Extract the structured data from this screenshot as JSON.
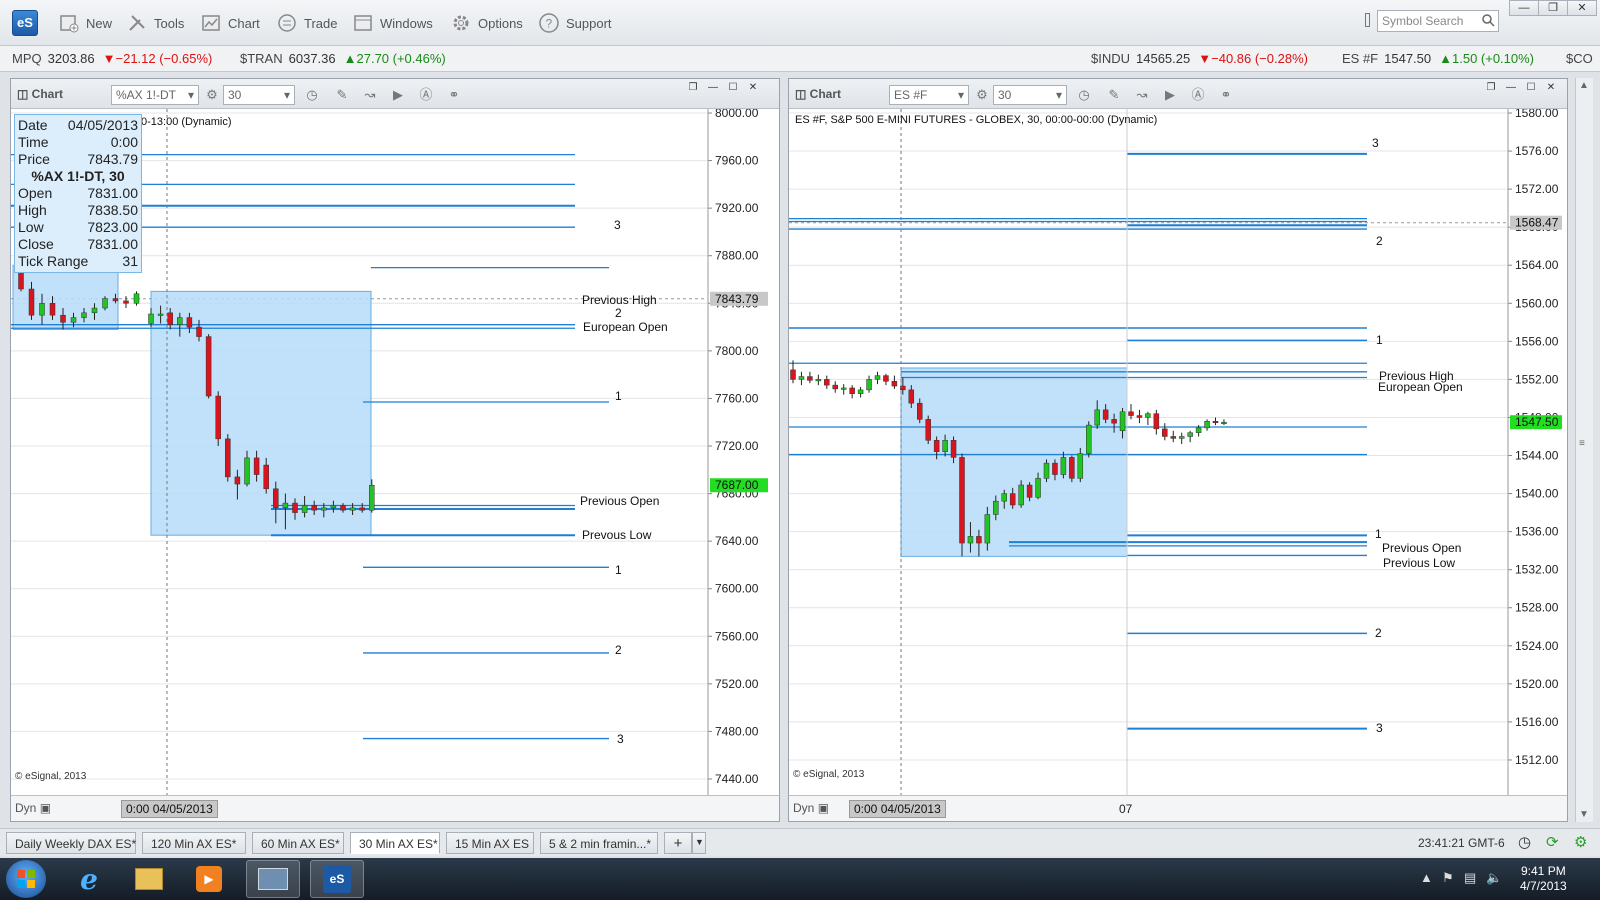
{
  "app": {
    "logo_text": "eS",
    "toolbar": [
      {
        "id": "new",
        "label": "New",
        "icon": "new-icon"
      },
      {
        "id": "tools",
        "label": "Tools",
        "icon": "tools-icon"
      },
      {
        "id": "chart",
        "label": "Chart",
        "icon": "chart-icon"
      },
      {
        "id": "trade",
        "label": "Trade",
        "icon": "trade-icon"
      },
      {
        "id": "windows",
        "label": "Windows",
        "icon": "windows-icon"
      },
      {
        "id": "options",
        "label": "Options",
        "icon": "gear-icon"
      },
      {
        "id": "support",
        "label": "Support",
        "icon": "help-icon"
      }
    ],
    "search_placeholder": "Symbol Search"
  },
  "ticker": [
    {
      "sym": "MPQ",
      "val": "3203.86",
      "chg": "▼−21.12 (−0.65%)",
      "dir": "down"
    },
    {
      "sym": "$TRAN",
      "val": "6037.36",
      "chg": "▲27.70 (+0.46%)",
      "dir": "up"
    },
    {
      "sym": "$INDU",
      "val": "14565.25",
      "chg": "▼−40.86 (−0.28%)",
      "dir": "down"
    },
    {
      "sym": "ES #F",
      "val": "1547.50",
      "chg": "▲1.50 (+0.10%)",
      "dir": "up"
    },
    {
      "sym": "$CO",
      "val": "",
      "chg": "",
      "dir": ""
    }
  ],
  "left_chart": {
    "header_title": "Chart",
    "symbol": "%AX 1!-DT",
    "interval": "30",
    "subtitle": "0-13:00 (Dynamic)",
    "copyright": "© eSignal, 2013",
    "footer_dyn": "Dyn",
    "footer_date": "0:00 04/05/2013",
    "last_price": "7687.00",
    "cursor_price": "7843.79",
    "tooltip": {
      "date_label": "Date",
      "date": "04/05/2013",
      "time_label": "Time",
      "time": "0:00",
      "price_label": "Price",
      "price": "7843.79",
      "symbol_title": "%AX 1!-DT, 30",
      "open_label": "Open",
      "open": "7831.00",
      "high_label": "High",
      "high": "7838.50",
      "low_label": "Low",
      "low": "7823.00",
      "close_label": "Close",
      "close": "7831.00",
      "range_label": "Tick Range",
      "range": "31"
    },
    "annotations": {
      "prev_high": "Previous High",
      "euro_open": "European Open",
      "prev_open": "Previous Open",
      "prev_low": "Prevous Low",
      "n3a": "3",
      "n2a": "2",
      "n1a": "1",
      "n1b": "1",
      "n2b": "2",
      "n3b": "3"
    }
  },
  "right_chart": {
    "header_title": "Chart",
    "symbol": "ES #F",
    "interval": "30",
    "subtitle": "ES #F, S&P 500 E-MINI FUTURES - GLOBEX, 30, 00:00-00:00 (Dynamic)",
    "copyright": "© eSignal, 2013",
    "footer_dyn": "Dyn",
    "footer_date": "0:00 04/05/2013",
    "footer_day": "07",
    "last_price": "1547.50",
    "cursor_price": "1568.47",
    "annotations": {
      "n3a": "3",
      "n2a": "2",
      "n1a": "1",
      "prev_high": "Previous High",
      "euro_open": "European Open",
      "n1b": "1",
      "prev_open": "Previous Open",
      "prev_low": "Previous Low",
      "n2b": "2",
      "n3b": "3"
    }
  },
  "chart_data": [
    {
      "type": "candlestick",
      "symbol": "%AX 1!-DT",
      "interval": "30",
      "ylim": [
        7440,
        8000
      ],
      "yticks": [
        "8000.00",
        "7960.00",
        "7920.00",
        "7880.00",
        "7840.00",
        "7800.00",
        "7760.00",
        "7720.00",
        "7680.00",
        "7640.00",
        "7600.00",
        "7560.00",
        "7520.00",
        "7480.00",
        "7440.00"
      ],
      "levels": [
        7965,
        7940,
        7922,
        7904,
        7870,
        7822,
        7819,
        7757,
        7670,
        7667,
        7645,
        7618,
        7546,
        7474
      ],
      "candles": [
        {
          "o": 7866,
          "h": 7872,
          "l": 7850,
          "c": 7852
        },
        {
          "o": 7852,
          "h": 7858,
          "l": 7826,
          "c": 7830
        },
        {
          "o": 7830,
          "h": 7848,
          "l": 7822,
          "c": 7840
        },
        {
          "o": 7840,
          "h": 7846,
          "l": 7826,
          "c": 7830
        },
        {
          "o": 7830,
          "h": 7836,
          "l": 7818,
          "c": 7824
        },
        {
          "o": 7824,
          "h": 7832,
          "l": 7820,
          "c": 7828
        },
        {
          "o": 7828,
          "h": 7836,
          "l": 7824,
          "c": 7832
        },
        {
          "o": 7832,
          "h": 7840,
          "l": 7826,
          "c": 7836
        },
        {
          "o": 7836,
          "h": 7846,
          "l": 7834,
          "c": 7844
        },
        {
          "o": 7844,
          "h": 7848,
          "l": 7840,
          "c": 7842
        },
        {
          "o": 7842,
          "h": 7846,
          "l": 7836,
          "c": 7840
        },
        {
          "o": 7840,
          "h": 7850,
          "l": 7838,
          "c": 7848
        },
        {
          "o": 7823,
          "h": 7836,
          "l": 7820,
          "c": 7831
        },
        {
          "o": 7831,
          "h": 7838,
          "l": 7823,
          "c": 7831
        },
        {
          "o": 7832,
          "h": 7836,
          "l": 7818,
          "c": 7822
        },
        {
          "o": 7822,
          "h": 7832,
          "l": 7812,
          "c": 7828
        },
        {
          "o": 7828,
          "h": 7832,
          "l": 7815,
          "c": 7820
        },
        {
          "o": 7820,
          "h": 7826,
          "l": 7808,
          "c": 7812
        },
        {
          "o": 7812,
          "h": 7814,
          "l": 7760,
          "c": 7762
        },
        {
          "o": 7762,
          "h": 7766,
          "l": 7720,
          "c": 7726
        },
        {
          "o": 7726,
          "h": 7730,
          "l": 7690,
          "c": 7694
        },
        {
          "o": 7694,
          "h": 7700,
          "l": 7675,
          "c": 7688
        },
        {
          "o": 7688,
          "h": 7716,
          "l": 7686,
          "c": 7710
        },
        {
          "o": 7710,
          "h": 7716,
          "l": 7690,
          "c": 7696
        },
        {
          "o": 7704,
          "h": 7710,
          "l": 7680,
          "c": 7684
        },
        {
          "o": 7684,
          "h": 7690,
          "l": 7655,
          "c": 7668
        },
        {
          "o": 7668,
          "h": 7680,
          "l": 7650,
          "c": 7672
        },
        {
          "o": 7672,
          "h": 7676,
          "l": 7658,
          "c": 7664
        },
        {
          "o": 7664,
          "h": 7678,
          "l": 7660,
          "c": 7670
        },
        {
          "o": 7670,
          "h": 7674,
          "l": 7662,
          "c": 7666
        },
        {
          "o": 7666,
          "h": 7672,
          "l": 7660,
          "c": 7668
        },
        {
          "o": 7668,
          "h": 7674,
          "l": 7664,
          "c": 7670
        },
        {
          "o": 7670,
          "h": 7672,
          "l": 7664,
          "c": 7666
        },
        {
          "o": 7666,
          "h": 7672,
          "l": 7662,
          "c": 7668
        },
        {
          "o": 7668,
          "h": 7672,
          "l": 7664,
          "c": 7666
        },
        {
          "o": 7666,
          "h": 7692,
          "l": 7664,
          "c": 7687
        }
      ]
    },
    {
      "type": "candlestick",
      "symbol": "ES #F",
      "interval": "30",
      "ylim": [
        1510,
        1580
      ],
      "yticks": [
        "1580.00",
        "1576.00",
        "1572.00",
        "1568.00",
        "1564.00",
        "1560.00",
        "1556.00",
        "1552.00",
        "1548.00",
        "1544.00",
        "1540.00",
        "1536.00",
        "1532.00",
        "1528.00",
        "1524.00",
        "1520.00",
        "1516.00",
        "1512.00"
      ],
      "levels": [
        1575.7,
        1568.9,
        1568.6,
        1568.2,
        1567.8,
        1557.4,
        1556.1,
        1553.7,
        1552.8,
        1552.2,
        1547.0,
        1544.1,
        1535.6,
        1534.9,
        1534.5,
        1533.5,
        1525.3,
        1515.3
      ],
      "candles": [
        {
          "o": 1553,
          "h": 1554,
          "l": 1551.6,
          "c": 1552
        },
        {
          "o": 1552,
          "h": 1552.8,
          "l": 1551.4,
          "c": 1552.3
        },
        {
          "o": 1552.3,
          "h": 1552.8,
          "l": 1551.6,
          "c": 1551.9
        },
        {
          "o": 1551.9,
          "h": 1552.5,
          "l": 1551.4,
          "c": 1552
        },
        {
          "o": 1552,
          "h": 1552.4,
          "l": 1551,
          "c": 1551.4
        },
        {
          "o": 1551.4,
          "h": 1551.8,
          "l": 1550.6,
          "c": 1551
        },
        {
          "o": 1551,
          "h": 1551.5,
          "l": 1550.4,
          "c": 1551.1
        },
        {
          "o": 1551.1,
          "h": 1551.4,
          "l": 1550,
          "c": 1550.5
        },
        {
          "o": 1550.5,
          "h": 1551.2,
          "l": 1550.1,
          "c": 1550.9
        },
        {
          "o": 1550.9,
          "h": 1552.4,
          "l": 1550.6,
          "c": 1552
        },
        {
          "o": 1552,
          "h": 1552.8,
          "l": 1551.5,
          "c": 1552.4
        },
        {
          "o": 1552.4,
          "h": 1552.6,
          "l": 1551.4,
          "c": 1551.8
        },
        {
          "o": 1551.8,
          "h": 1552.4,
          "l": 1551,
          "c": 1551.3
        },
        {
          "o": 1551.3,
          "h": 1552.2,
          "l": 1550.4,
          "c": 1550.9
        },
        {
          "o": 1550.9,
          "h": 1551.4,
          "l": 1549,
          "c": 1549.5
        },
        {
          "o": 1549.5,
          "h": 1550,
          "l": 1547.4,
          "c": 1547.8
        },
        {
          "o": 1547.8,
          "h": 1548.2,
          "l": 1545.2,
          "c": 1545.6
        },
        {
          "o": 1545.6,
          "h": 1546,
          "l": 1543.6,
          "c": 1544.4
        },
        {
          "o": 1544.4,
          "h": 1546.2,
          "l": 1543.9,
          "c": 1545.6
        },
        {
          "o": 1545.6,
          "h": 1546,
          "l": 1543.2,
          "c": 1543.8
        },
        {
          "o": 1543.8,
          "h": 1544.2,
          "l": 1533.4,
          "c": 1534.8
        },
        {
          "o": 1534.8,
          "h": 1537,
          "l": 1533.8,
          "c": 1535.5
        },
        {
          "o": 1535.5,
          "h": 1536.2,
          "l": 1533.4,
          "c": 1534.8
        },
        {
          "o": 1534.8,
          "h": 1538.6,
          "l": 1534,
          "c": 1537.8
        },
        {
          "o": 1537.8,
          "h": 1539.8,
          "l": 1537.2,
          "c": 1539.2
        },
        {
          "o": 1539.2,
          "h": 1540.4,
          "l": 1538.4,
          "c": 1540
        },
        {
          "o": 1540,
          "h": 1540.6,
          "l": 1538.4,
          "c": 1538.8
        },
        {
          "o": 1538.8,
          "h": 1541.4,
          "l": 1538.5,
          "c": 1540.9
        },
        {
          "o": 1540.9,
          "h": 1541.2,
          "l": 1539.2,
          "c": 1539.6
        },
        {
          "o": 1539.6,
          "h": 1542.2,
          "l": 1539.4,
          "c": 1541.6
        },
        {
          "o": 1541.6,
          "h": 1543.6,
          "l": 1541.2,
          "c": 1543.2
        },
        {
          "o": 1543.2,
          "h": 1543.6,
          "l": 1541.4,
          "c": 1542
        },
        {
          "o": 1542,
          "h": 1544.4,
          "l": 1541.6,
          "c": 1543.8
        },
        {
          "o": 1543.8,
          "h": 1544,
          "l": 1541.2,
          "c": 1541.6
        },
        {
          "o": 1541.6,
          "h": 1544.8,
          "l": 1541.2,
          "c": 1544.2
        },
        {
          "o": 1544.2,
          "h": 1547.6,
          "l": 1543.8,
          "c": 1547.2
        },
        {
          "o": 1547.2,
          "h": 1549.8,
          "l": 1546.8,
          "c": 1548.8
        },
        {
          "o": 1548.8,
          "h": 1549.4,
          "l": 1547.4,
          "c": 1547.8
        },
        {
          "o": 1547.8,
          "h": 1548.4,
          "l": 1546.4,
          "c": 1547.4
        },
        {
          "o": 1546.6,
          "h": 1549,
          "l": 1545.8,
          "c": 1548.6
        },
        {
          "o": 1548.6,
          "h": 1549.4,
          "l": 1547.8,
          "c": 1548.2
        },
        {
          "o": 1548.2,
          "h": 1548.8,
          "l": 1547.4,
          "c": 1548
        },
        {
          "o": 1548,
          "h": 1548.6,
          "l": 1547.2,
          "c": 1548.4
        },
        {
          "o": 1548.4,
          "h": 1548.8,
          "l": 1546.2,
          "c": 1546.8
        },
        {
          "o": 1546.8,
          "h": 1547.4,
          "l": 1545.6,
          "c": 1546
        },
        {
          "o": 1546,
          "h": 1546.6,
          "l": 1545.4,
          "c": 1545.8
        },
        {
          "o": 1545.8,
          "h": 1546.4,
          "l": 1545.2,
          "c": 1546
        },
        {
          "o": 1546,
          "h": 1546.6,
          "l": 1545.4,
          "c": 1546.4
        },
        {
          "o": 1546.4,
          "h": 1547.2,
          "l": 1546,
          "c": 1546.9
        },
        {
          "o": 1546.9,
          "h": 1547.8,
          "l": 1546.6,
          "c": 1547.6
        },
        {
          "o": 1547.6,
          "h": 1548,
          "l": 1547.2,
          "c": 1547.5
        },
        {
          "o": 1547.5,
          "h": 1547.8,
          "l": 1547.2,
          "c": 1547.5
        }
      ]
    }
  ],
  "tabs": [
    {
      "label": "Daily Weekly DAX ES*",
      "active": false
    },
    {
      "label": "120 Min AX ES*",
      "active": false
    },
    {
      "label": "60 Min AX ES*",
      "active": false
    },
    {
      "label": "30 Min AX ES*",
      "active": true
    },
    {
      "label": "15 Min AX ES",
      "active": false
    },
    {
      "label": "5 & 2 min framin...*",
      "active": false
    }
  ],
  "statusbar": {
    "time": "23:41:21 GMT-6"
  },
  "taskbar": {
    "time": "9:41 PM",
    "date": "4/7/2013"
  },
  "colors": {
    "up": "#22c322",
    "down": "#d8141e",
    "level": "#1f7fd2",
    "box": "#b6dcf9",
    "last_tag": "#22dd22"
  }
}
